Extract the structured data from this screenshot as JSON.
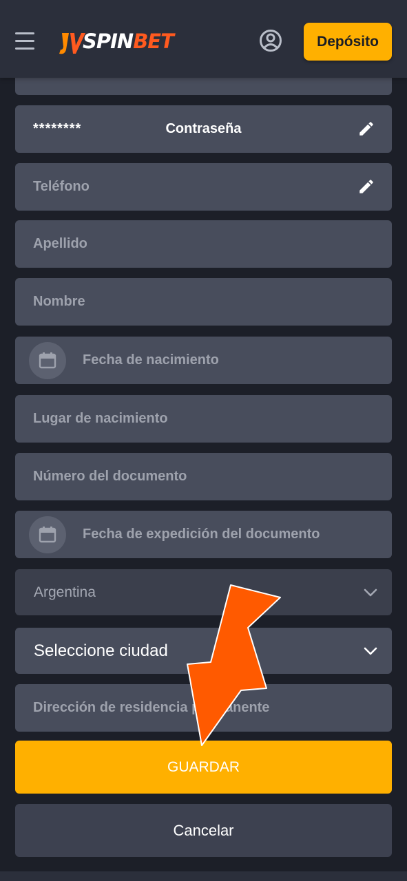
{
  "header": {
    "logo_text_spin": "SPIN",
    "logo_text_bet": "BET",
    "menu_icon": "hamburger-menu-icon",
    "profile_icon": "user-circle-icon",
    "deposit_label": "Depósito"
  },
  "form": {
    "password": {
      "masked_value": "********",
      "label": "Contraseña",
      "icon": "pencil-icon"
    },
    "phone": {
      "placeholder": "Teléfono",
      "icon": "pencil-icon"
    },
    "last_name": {
      "placeholder": "Apellido"
    },
    "first_name": {
      "placeholder": "Nombre"
    },
    "birth_date": {
      "placeholder": "Fecha de nacimiento",
      "icon": "calendar-icon"
    },
    "birth_place": {
      "placeholder": "Lugar de nacimiento"
    },
    "document_number": {
      "placeholder": "Número del documento"
    },
    "document_issue_date": {
      "placeholder": "Fecha de expedición del documento",
      "icon": "calendar-icon"
    },
    "country": {
      "value": "Argentina",
      "icon": "chevron-down-icon"
    },
    "city": {
      "value": "Seleccione ciudad",
      "icon": "chevron-down-icon"
    },
    "address": {
      "placeholder": "Dirección de residencia permanente"
    }
  },
  "actions": {
    "save_label": "GUARDAR",
    "cancel_label": "Cancelar"
  },
  "colors": {
    "background": "#1c1f28",
    "header": "#2b2f3b",
    "field": "#484d5c",
    "accent": "#ffb000",
    "arrow": "#ff5a00"
  }
}
